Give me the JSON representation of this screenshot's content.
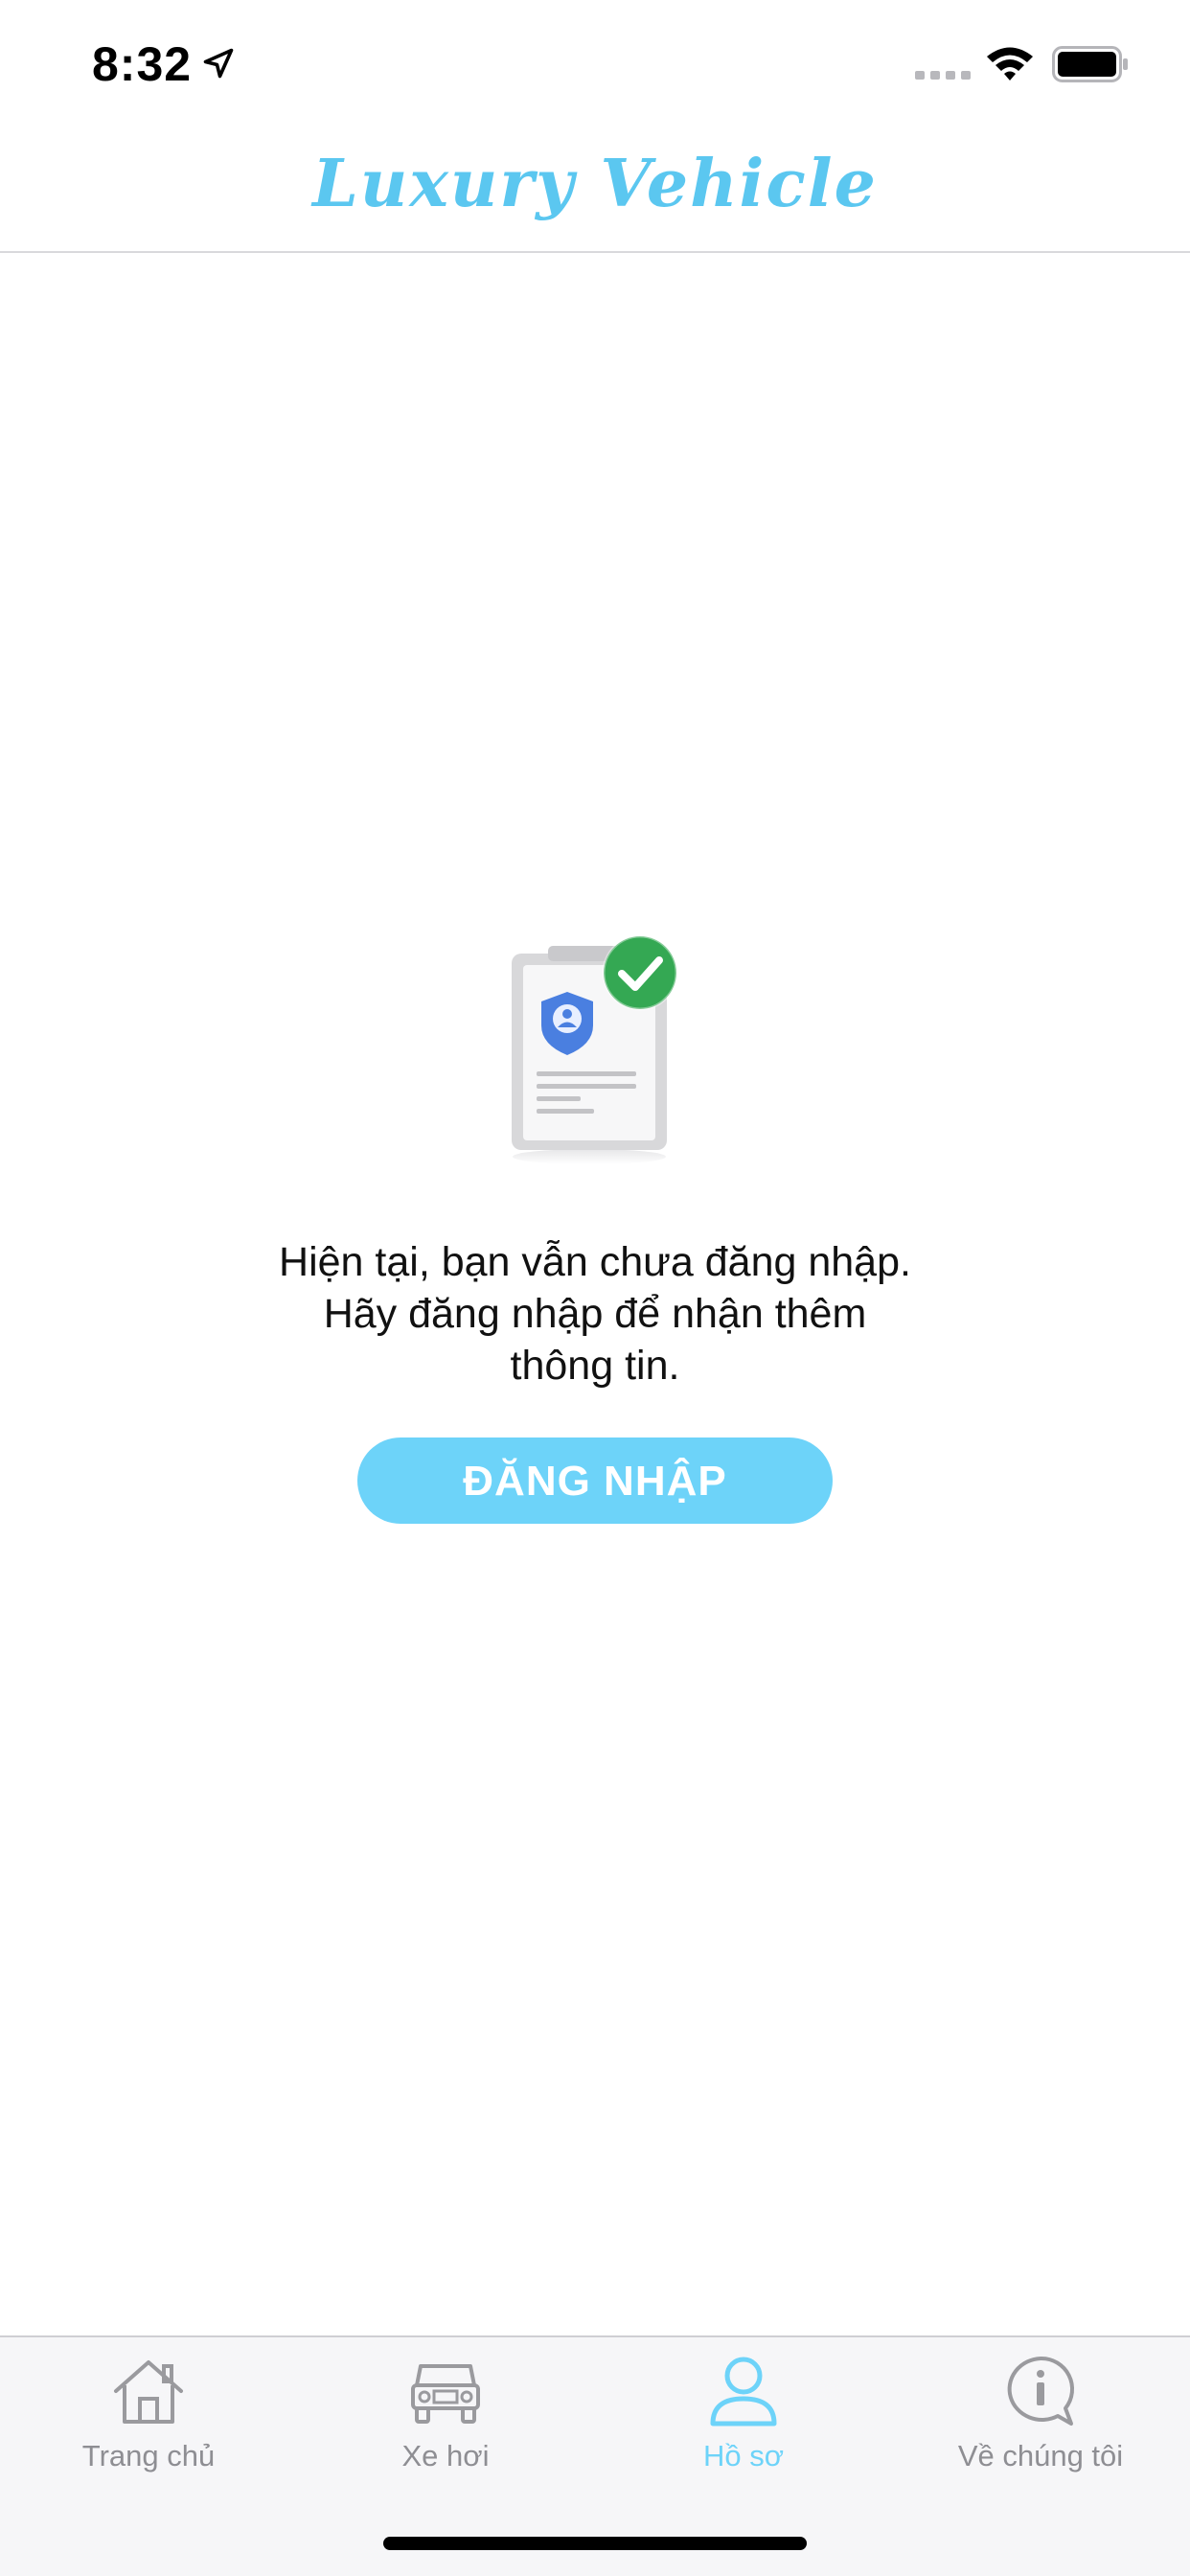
{
  "status_bar": {
    "time": "8:32"
  },
  "header": {
    "title": "Luxury Vehicle"
  },
  "main": {
    "message_lines": [
      "Hiện tại, bạn vẫn chưa đăng nhập.",
      "Hãy đăng nhập để nhận thêm",
      "thông tin."
    ],
    "login_button_label": "ĐĂNG NHẬP"
  },
  "tabs": [
    {
      "label": "Trang chủ",
      "icon": "home-icon",
      "active": false
    },
    {
      "label": "Xe hơi",
      "icon": "car-icon",
      "active": false
    },
    {
      "label": "Hồ sơ",
      "icon": "person-icon",
      "active": true
    },
    {
      "label": "Về chúng tôi",
      "icon": "info-icon",
      "active": false
    }
  ],
  "colors": {
    "accent": "#6dd3f9",
    "title": "#5bc7f0",
    "inactive_tab": "#8e8e93",
    "check_badge": "#34a853",
    "shield": "#4a7fe0"
  }
}
